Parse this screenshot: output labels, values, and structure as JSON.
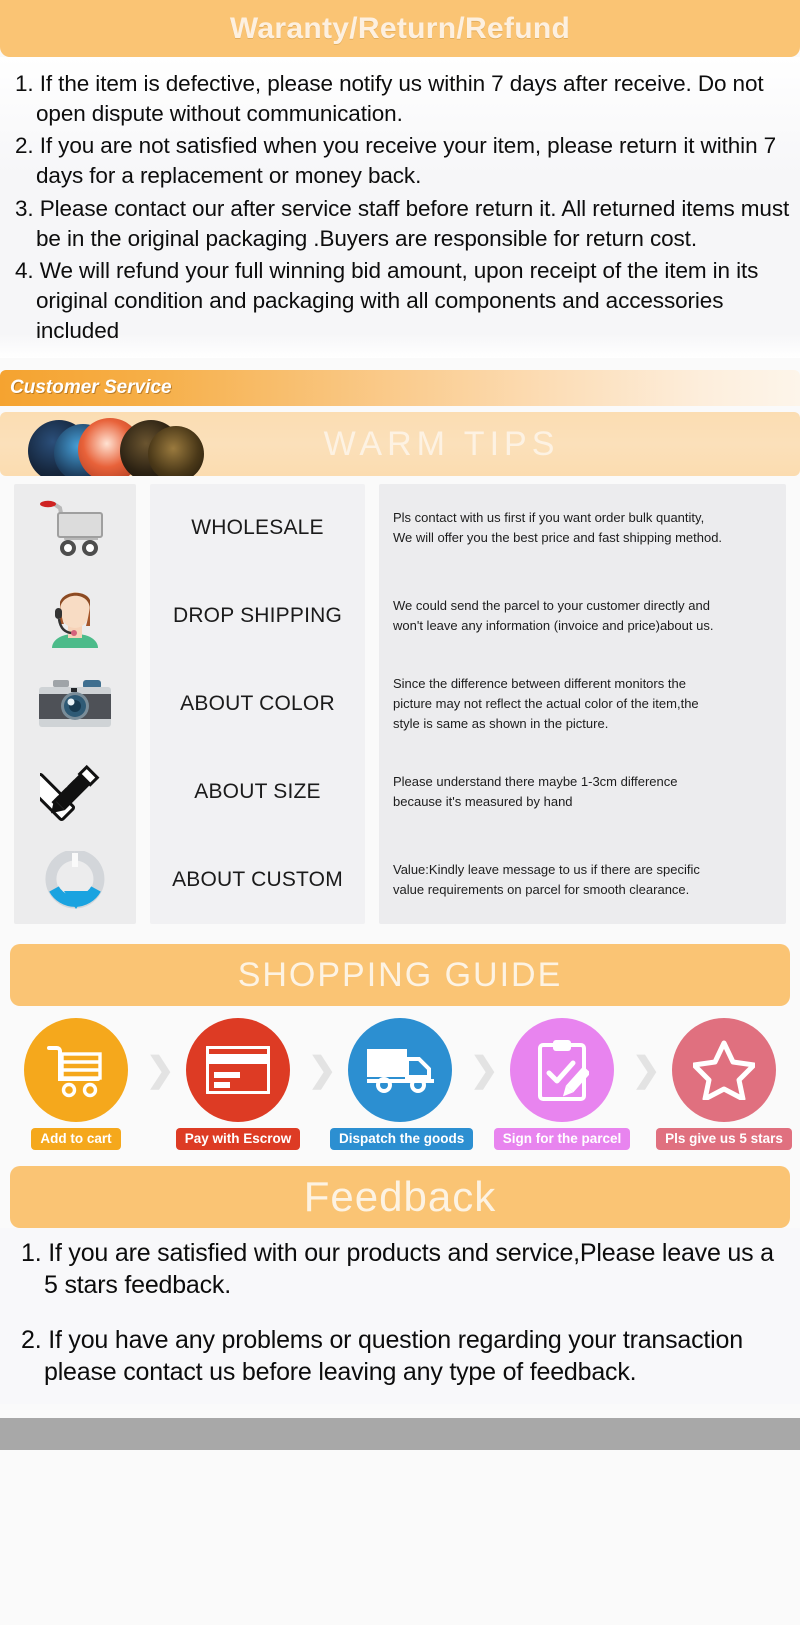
{
  "warranty": {
    "title": "Waranty/Return/Refund",
    "items": [
      "1. If the item is defective, please notify us within 7 days after receive. Do not open dispute without communication.",
      "2. If you are not satisfied when you receive your item, please return it within 7 days for a replacement or money back.",
      "3. Please contact our after service staff before return it. All returned items must be in the original packaging .Buyers are responsible for return cost.",
      "4. We will refund your full winning bid amount, upon receipt of the item in its original condition and packaging with all components and accessories included"
    ]
  },
  "customer_service": {
    "label": "Customer Service"
  },
  "warm_tips": {
    "title": "WARM TIPS",
    "rows": [
      {
        "icon": "shopping-cart-icon",
        "name": "WHOLESALE",
        "desc_lines": [
          "Pls contact with us first if you want order bulk quantity,",
          "We will offer you the best price and fast shipping method."
        ]
      },
      {
        "icon": "customer-support-agent-icon",
        "name": "DROP SHIPPING",
        "desc_lines": [
          "We could send the parcel to your customer directly and",
          "won't leave any information (invoice and price)about us."
        ]
      },
      {
        "icon": "camera-icon",
        "name": "ABOUT COLOR",
        "desc_lines": [
          "Since the difference between different monitors the",
          "picture may not reflect the actual color of the item,the",
          "style is same as shown in the picture."
        ]
      },
      {
        "icon": "ruler-pencil-icon",
        "name": "ABOUT SIZE",
        "desc_lines": [
          "Please understand there maybe 1-3cm difference",
          "because it's measured by hand"
        ]
      },
      {
        "icon": "custom-loading-icon",
        "name": "ABOUT CUSTOM",
        "desc_lines": [
          "Value:Kindly leave message to us if there are specific",
          "value requirements on parcel for smooth clearance."
        ]
      }
    ]
  },
  "shopping_guide": {
    "title": "SHOPPING GUIDE",
    "separator": "❯",
    "steps": [
      {
        "icon": "cart-icon",
        "label": "Add to cart",
        "color": "#f5a81c"
      },
      {
        "icon": "credit-card-icon",
        "label": "Pay with Escrow",
        "color": "#dd3b24"
      },
      {
        "icon": "truck-icon",
        "label": "Dispatch the goods",
        "color": "#2c8fd1"
      },
      {
        "icon": "clipboard-check-icon",
        "label": "Sign for the parcel",
        "color": "#e884ef"
      },
      {
        "icon": "star-icon",
        "label": "Pls give us 5 stars",
        "color": "#e0707f"
      }
    ]
  },
  "feedback": {
    "title": "Feedback",
    "items": [
      "1. If you are satisfied with our products and service,Please leave us a 5 stars feedback.",
      "2. If you have any problems or question regarding your transaction please contact us before leaving any type of feedback."
    ]
  },
  "theme": {
    "banner": "#fac474",
    "banner_text": "#fdf3e3",
    "footer_bar": "#a8a8a8"
  }
}
